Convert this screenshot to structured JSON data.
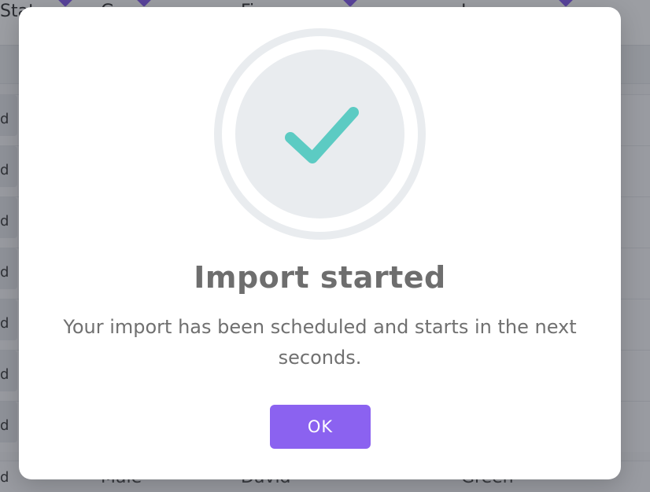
{
  "background_table": {
    "columns": [
      {
        "label": "Stat",
        "key": "status"
      },
      {
        "label": "G",
        "key": "gender"
      },
      {
        "label": "Fi",
        "key": "first_name"
      },
      {
        "label": "L",
        "key": "last_name"
      }
    ],
    "row_status_fragments": [
      "d",
      "d",
      "d",
      "d",
      "d",
      "d",
      "d"
    ],
    "last_row": {
      "status": "d",
      "gender": "Male",
      "first_name": "David",
      "last_name": "Green"
    }
  },
  "modal": {
    "icon": "check-icon",
    "title": "Import started",
    "message": "Your import has been scheduled and starts in the next seconds.",
    "ok_label": "OK"
  },
  "colors": {
    "accent": "#8b62f0",
    "check": "#5ccbc3",
    "ring": "#e9ecef",
    "overlay": "rgba(20,24,36,0.42)"
  }
}
